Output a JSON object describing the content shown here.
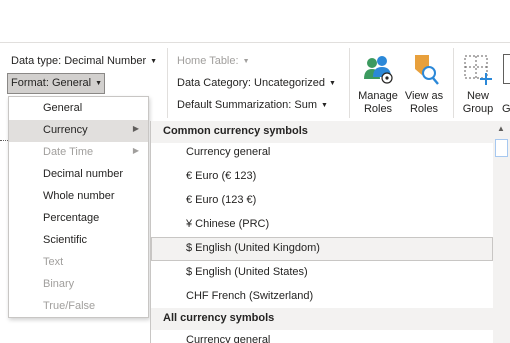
{
  "ribbon": {
    "data_type_label": "Data type: Decimal Number",
    "format_label": "Format: General",
    "home_table_label": "Home Table:",
    "data_category_label": "Data Category: Uncategorized",
    "default_summarization_label": "Default Summarization: Sum",
    "manage_roles_label_line1": "Manage",
    "manage_roles_label_line2": "Roles",
    "view_as_roles_label_line1": "View as",
    "view_as_roles_label_line2": "Roles",
    "new_group_label_line1": "New",
    "new_group_label_line2": "Group",
    "cut_off_label": "G"
  },
  "format_menu": {
    "items": [
      {
        "label": "General",
        "enabled": true,
        "submenu": false
      },
      {
        "label": "Currency",
        "enabled": true,
        "submenu": true,
        "highlighted": true
      },
      {
        "label": "Date Time",
        "enabled": false,
        "submenu": true
      },
      {
        "label": "Decimal number",
        "enabled": true,
        "submenu": false
      },
      {
        "label": "Whole number",
        "enabled": true,
        "submenu": false
      },
      {
        "label": "Percentage",
        "enabled": true,
        "submenu": false
      },
      {
        "label": "Scientific",
        "enabled": true,
        "submenu": false
      },
      {
        "label": "Text",
        "enabled": false,
        "submenu": false
      },
      {
        "label": "Binary",
        "enabled": false,
        "submenu": false
      },
      {
        "label": "True/False",
        "enabled": false,
        "submenu": false
      }
    ]
  },
  "currency_menu": {
    "group1_header": "Common currency symbols",
    "group1_items": [
      "Currency general",
      "€ Euro (€ 123)",
      "€ Euro (123 €)",
      "¥ Chinese (PRC)",
      "$ English (United Kingdom)",
      "$ English (United States)",
      "CHF French (Switzerland)"
    ],
    "hovered_item": "$ English (United Kingdom)",
    "group2_header": "All currency symbols",
    "group2_items": [
      "Currency general"
    ]
  },
  "colors": {
    "accent_blue": "#2b88d8",
    "orange": "#e8a03c",
    "green": "#3c9a5f"
  }
}
